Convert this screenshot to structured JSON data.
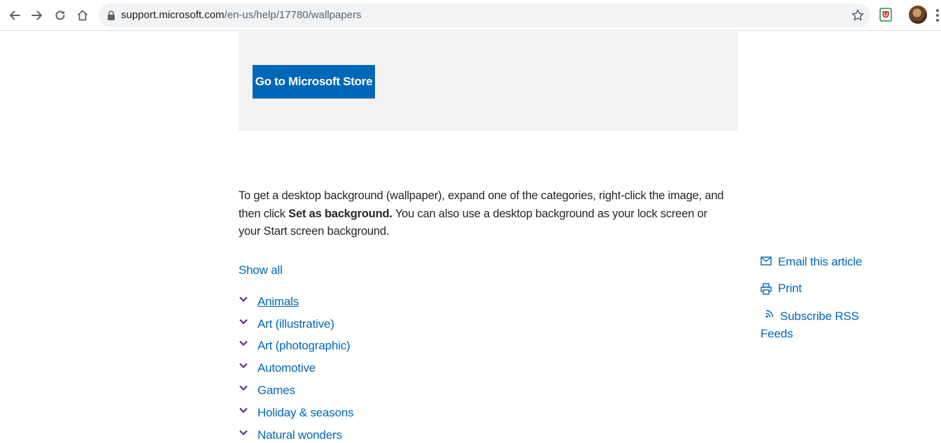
{
  "browser": {
    "url_domain": "support.microsoft.com",
    "url_path": "/en-us/help/17780/wallpapers",
    "icons": [
      "back-icon",
      "forward-icon",
      "reload-icon",
      "home-icon",
      "lock-icon",
      "star-icon",
      "extension-icon",
      "avatar",
      "menu-icon"
    ]
  },
  "promo": {
    "button_label": "Go to Microsoft Store"
  },
  "intro": {
    "part1": "To get a desktop background (wallpaper), expand one of the categories, right-click the image, and then click ",
    "bold": "Set as background.",
    "part2": " You can also use a desktop background as your lock screen or your Start screen background."
  },
  "show_all_label": "Show all",
  "categories": [
    {
      "label": "Animals"
    },
    {
      "label": "Art (illustrative)"
    },
    {
      "label": "Art (photographic)"
    },
    {
      "label": "Automotive"
    },
    {
      "label": "Games"
    },
    {
      "label": "Holiday & seasons"
    },
    {
      "label": "Natural wonders"
    }
  ],
  "side_links": {
    "email": "Email this article",
    "print": "Print",
    "rss": "Subscribe RSS Feeds"
  },
  "colors": {
    "accent": "#0067b8",
    "chevron": "#5c2d91",
    "promo_background": "#f2f2f2",
    "text": "#262626"
  }
}
